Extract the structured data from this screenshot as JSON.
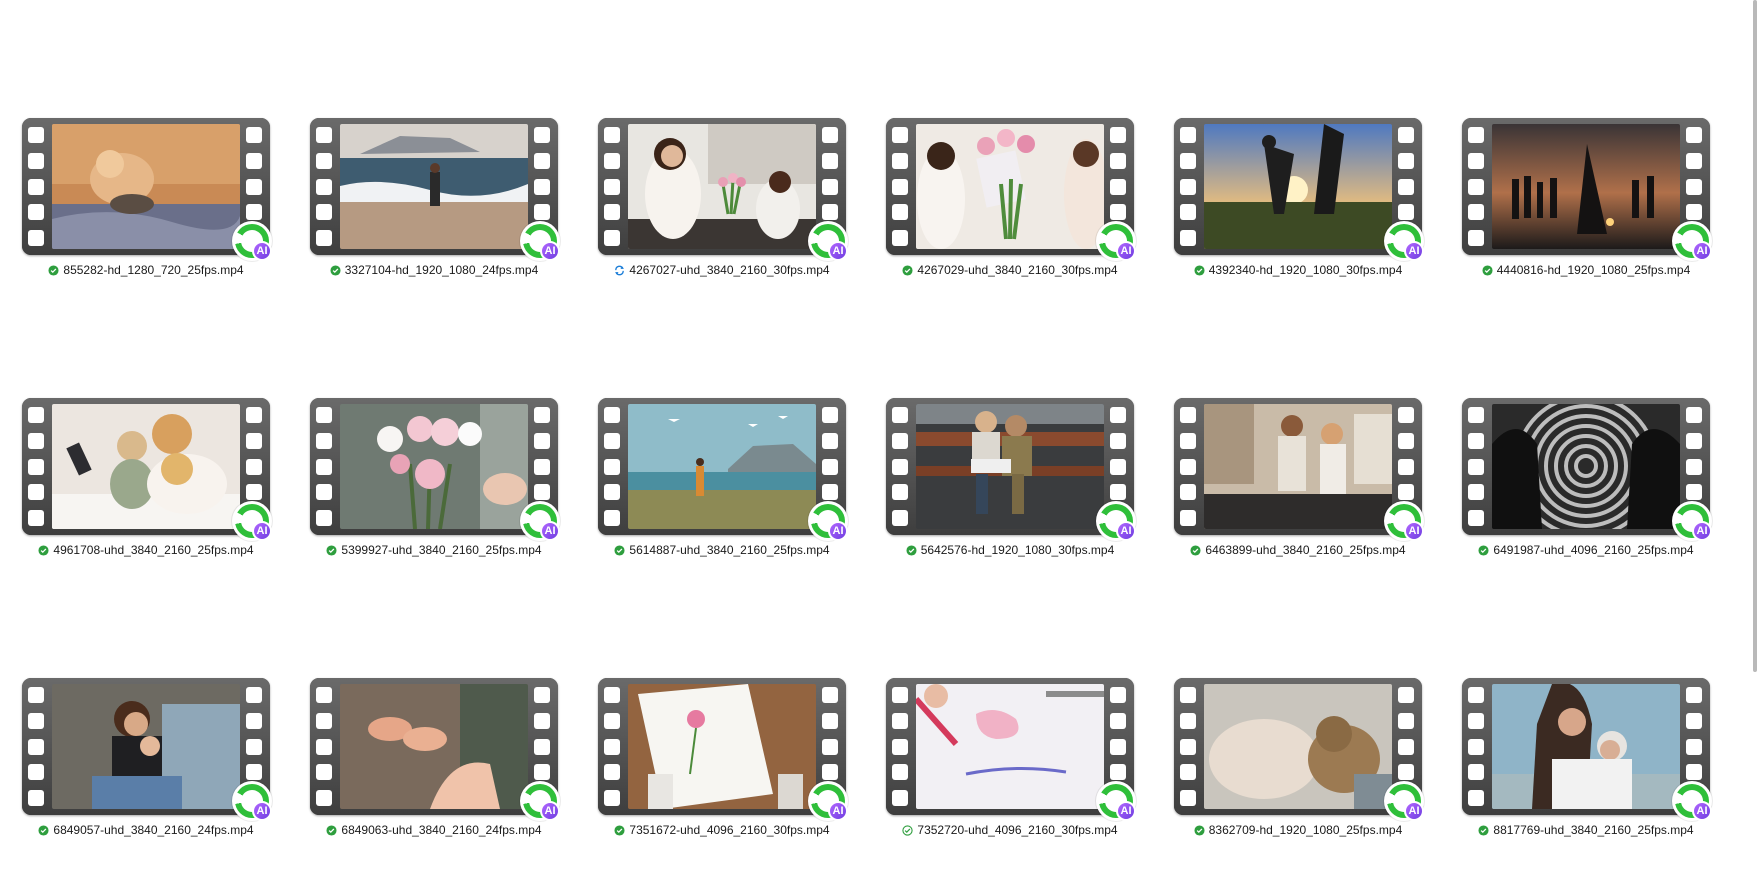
{
  "files": [
    {
      "name": "855282-hd_1280_720_25fps.mp4",
      "status": "synced",
      "scene": "cat"
    },
    {
      "name": "3327104-hd_1920_1080_24fps.mp4",
      "status": "synced",
      "scene": "beach"
    },
    {
      "name": "4267027-uhd_3840_2160_30fps.mp4",
      "status": "syncing",
      "scene": "kitchen"
    },
    {
      "name": "4267029-uhd_3840_2160_30fps.mp4",
      "status": "synced",
      "scene": "tulips"
    },
    {
      "name": "4392340-hd_1920_1080_30fps.mp4",
      "status": "synced",
      "scene": "sunset-play"
    },
    {
      "name": "4440816-hd_1920_1080_25fps.mp4",
      "status": "synced",
      "scene": "sunset-crowd"
    },
    {
      "name": "4961708-uhd_3840_2160_25fps.mp4",
      "status": "synced",
      "scene": "family-tablet"
    },
    {
      "name": "5399927-uhd_3840_2160_25fps.mp4",
      "status": "synced",
      "scene": "carnations"
    },
    {
      "name": "5614887-uhd_3840_2160_25fps.mp4",
      "status": "synced",
      "scene": "coast"
    },
    {
      "name": "5642576-hd_1920_1080_30fps.mp4",
      "status": "synced",
      "scene": "bench"
    },
    {
      "name": "6463899-uhd_3840_2160_25fps.mp4",
      "status": "synced",
      "scene": "living-room"
    },
    {
      "name": "6491987-uhd_4096_2160_25fps.mp4",
      "status": "synced",
      "scene": "spiral"
    },
    {
      "name": "6849057-uhd_3840_2160_24fps.mp4",
      "status": "synced",
      "scene": "baby"
    },
    {
      "name": "6849063-uhd_3840_2160_24fps.mp4",
      "status": "synced",
      "scene": "baby-feet"
    },
    {
      "name": "7351672-uhd_4096_2160_30fps.mp4",
      "status": "synced",
      "scene": "card"
    },
    {
      "name": "7352720-uhd_4096_2160_30fps.mp4",
      "status": "available",
      "scene": "drawing"
    },
    {
      "name": "8362709-hd_1920_1080_25fps.mp4",
      "status": "synced",
      "scene": "cat-pregnant"
    },
    {
      "name": "8817769-uhd_3840_2160_25fps.mp4",
      "status": "synced",
      "scene": "hug"
    }
  ],
  "badge": {
    "text": "AI",
    "ring_color": "#2fbf3a",
    "ai_color": "#8a4fff"
  },
  "status_colors": {
    "synced": "#2e9e3e",
    "syncing": "#1e7fd8",
    "available": "#2e9e3e"
  }
}
